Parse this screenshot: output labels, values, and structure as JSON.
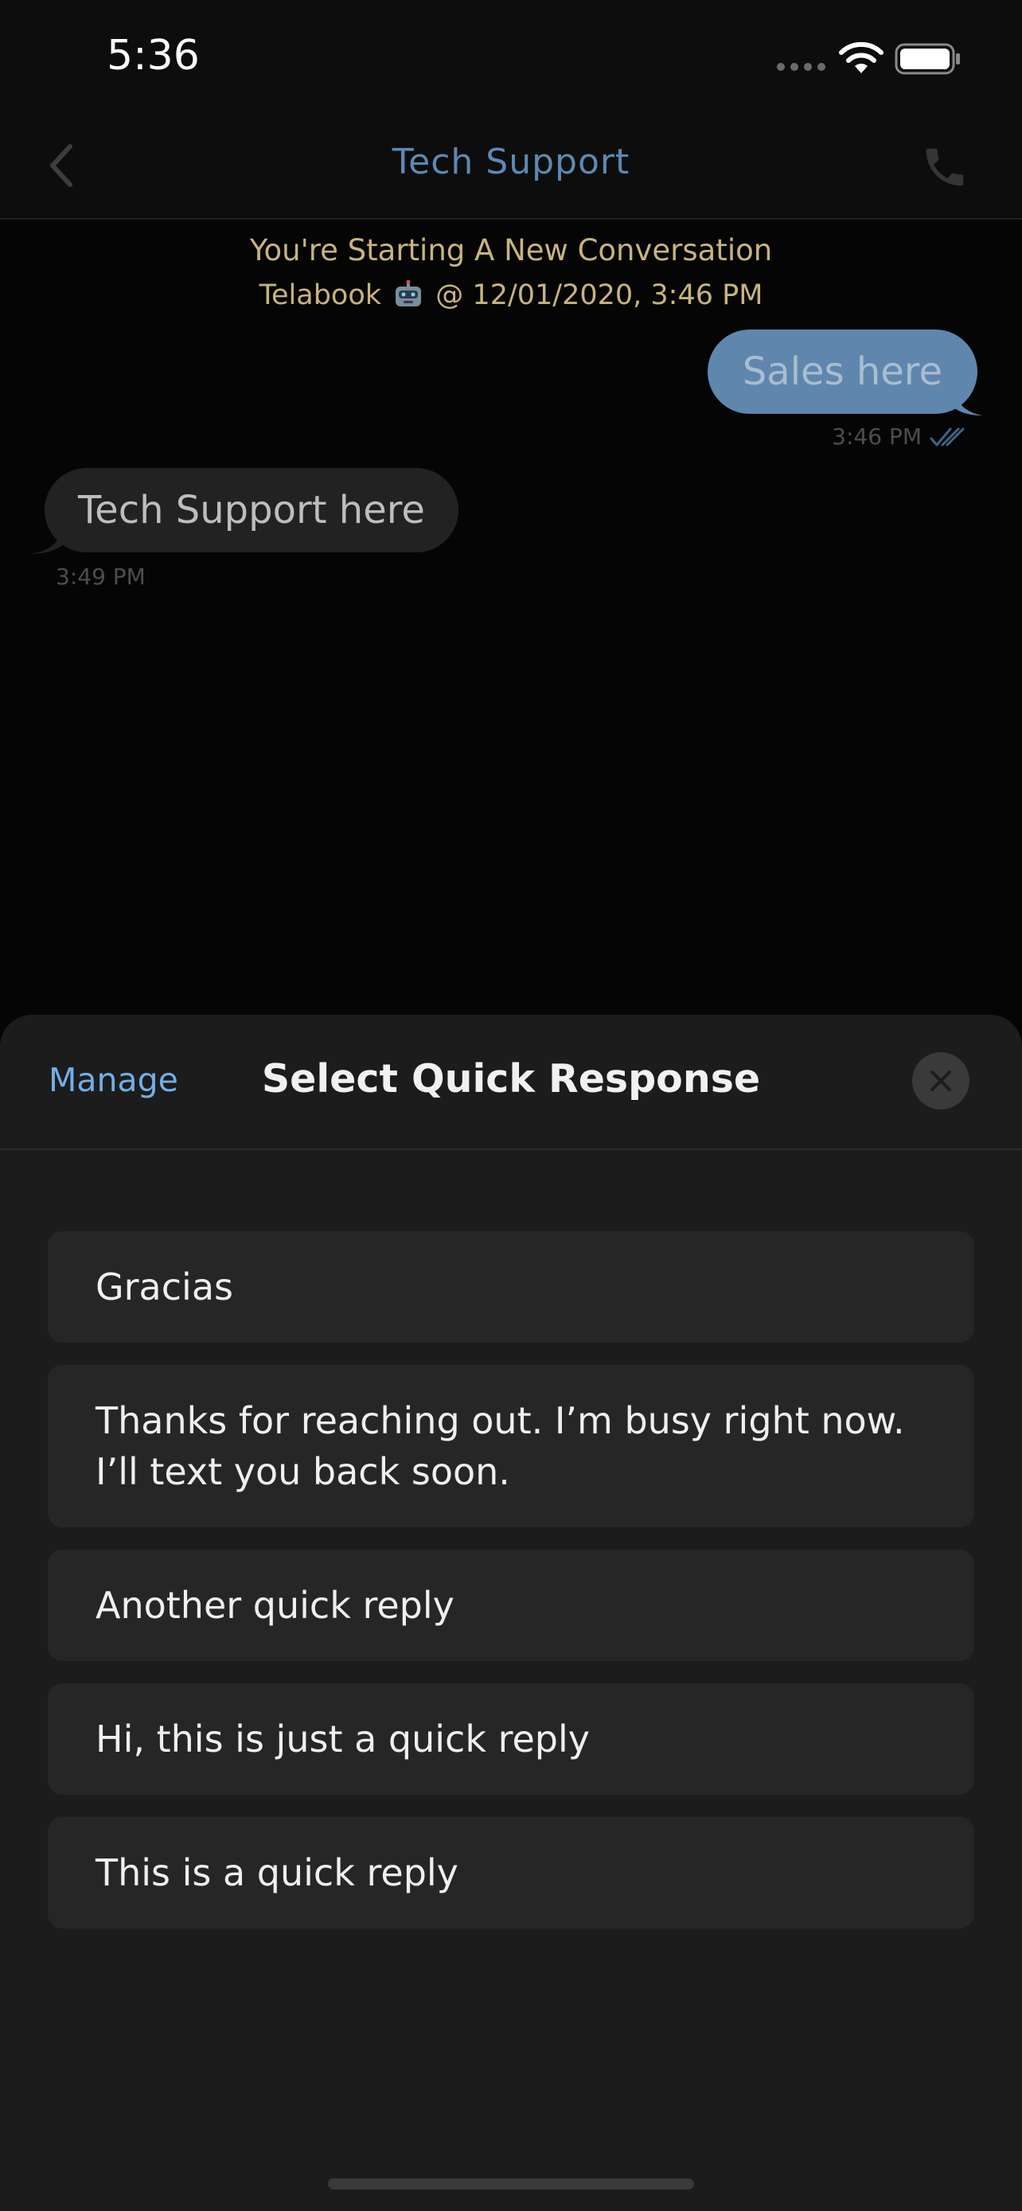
{
  "status_bar": {
    "time": "5:36"
  },
  "nav": {
    "title": "Tech Support"
  },
  "conversation": {
    "header_line1": "You're Starting A New Conversation",
    "header_sender": "Telabook",
    "header_timestamp": "@ 12/01/2020, 3:46 PM",
    "messages": [
      {
        "direction": "outgoing",
        "text": "Sales here",
        "time": "3:46 PM",
        "status": "read"
      },
      {
        "direction": "incoming",
        "text": "Tech Support here",
        "time": "3:49 PM"
      }
    ]
  },
  "quick_response_sheet": {
    "manage_label": "Manage",
    "title": "Select Quick Response",
    "items": [
      {
        "text": "Gracias"
      },
      {
        "text": "Thanks for reaching out. I’m busy right now. I’ll text you back soon."
      },
      {
        "text": "Another quick reply"
      },
      {
        "text": "Hi, this is just a quick reply"
      },
      {
        "text": "This is a quick reply"
      }
    ]
  },
  "colors": {
    "nav_title": "#5c89b3",
    "outgoing_bubble": "#5f86ad",
    "incoming_bubble": "#222222",
    "manage_link": "#72aee6",
    "system_text": "#c7b47e"
  },
  "icons": [
    "chevron-left-icon",
    "phone-icon",
    "wifi-icon",
    "battery-icon",
    "robot-icon",
    "double-check-icon",
    "close-icon"
  ]
}
